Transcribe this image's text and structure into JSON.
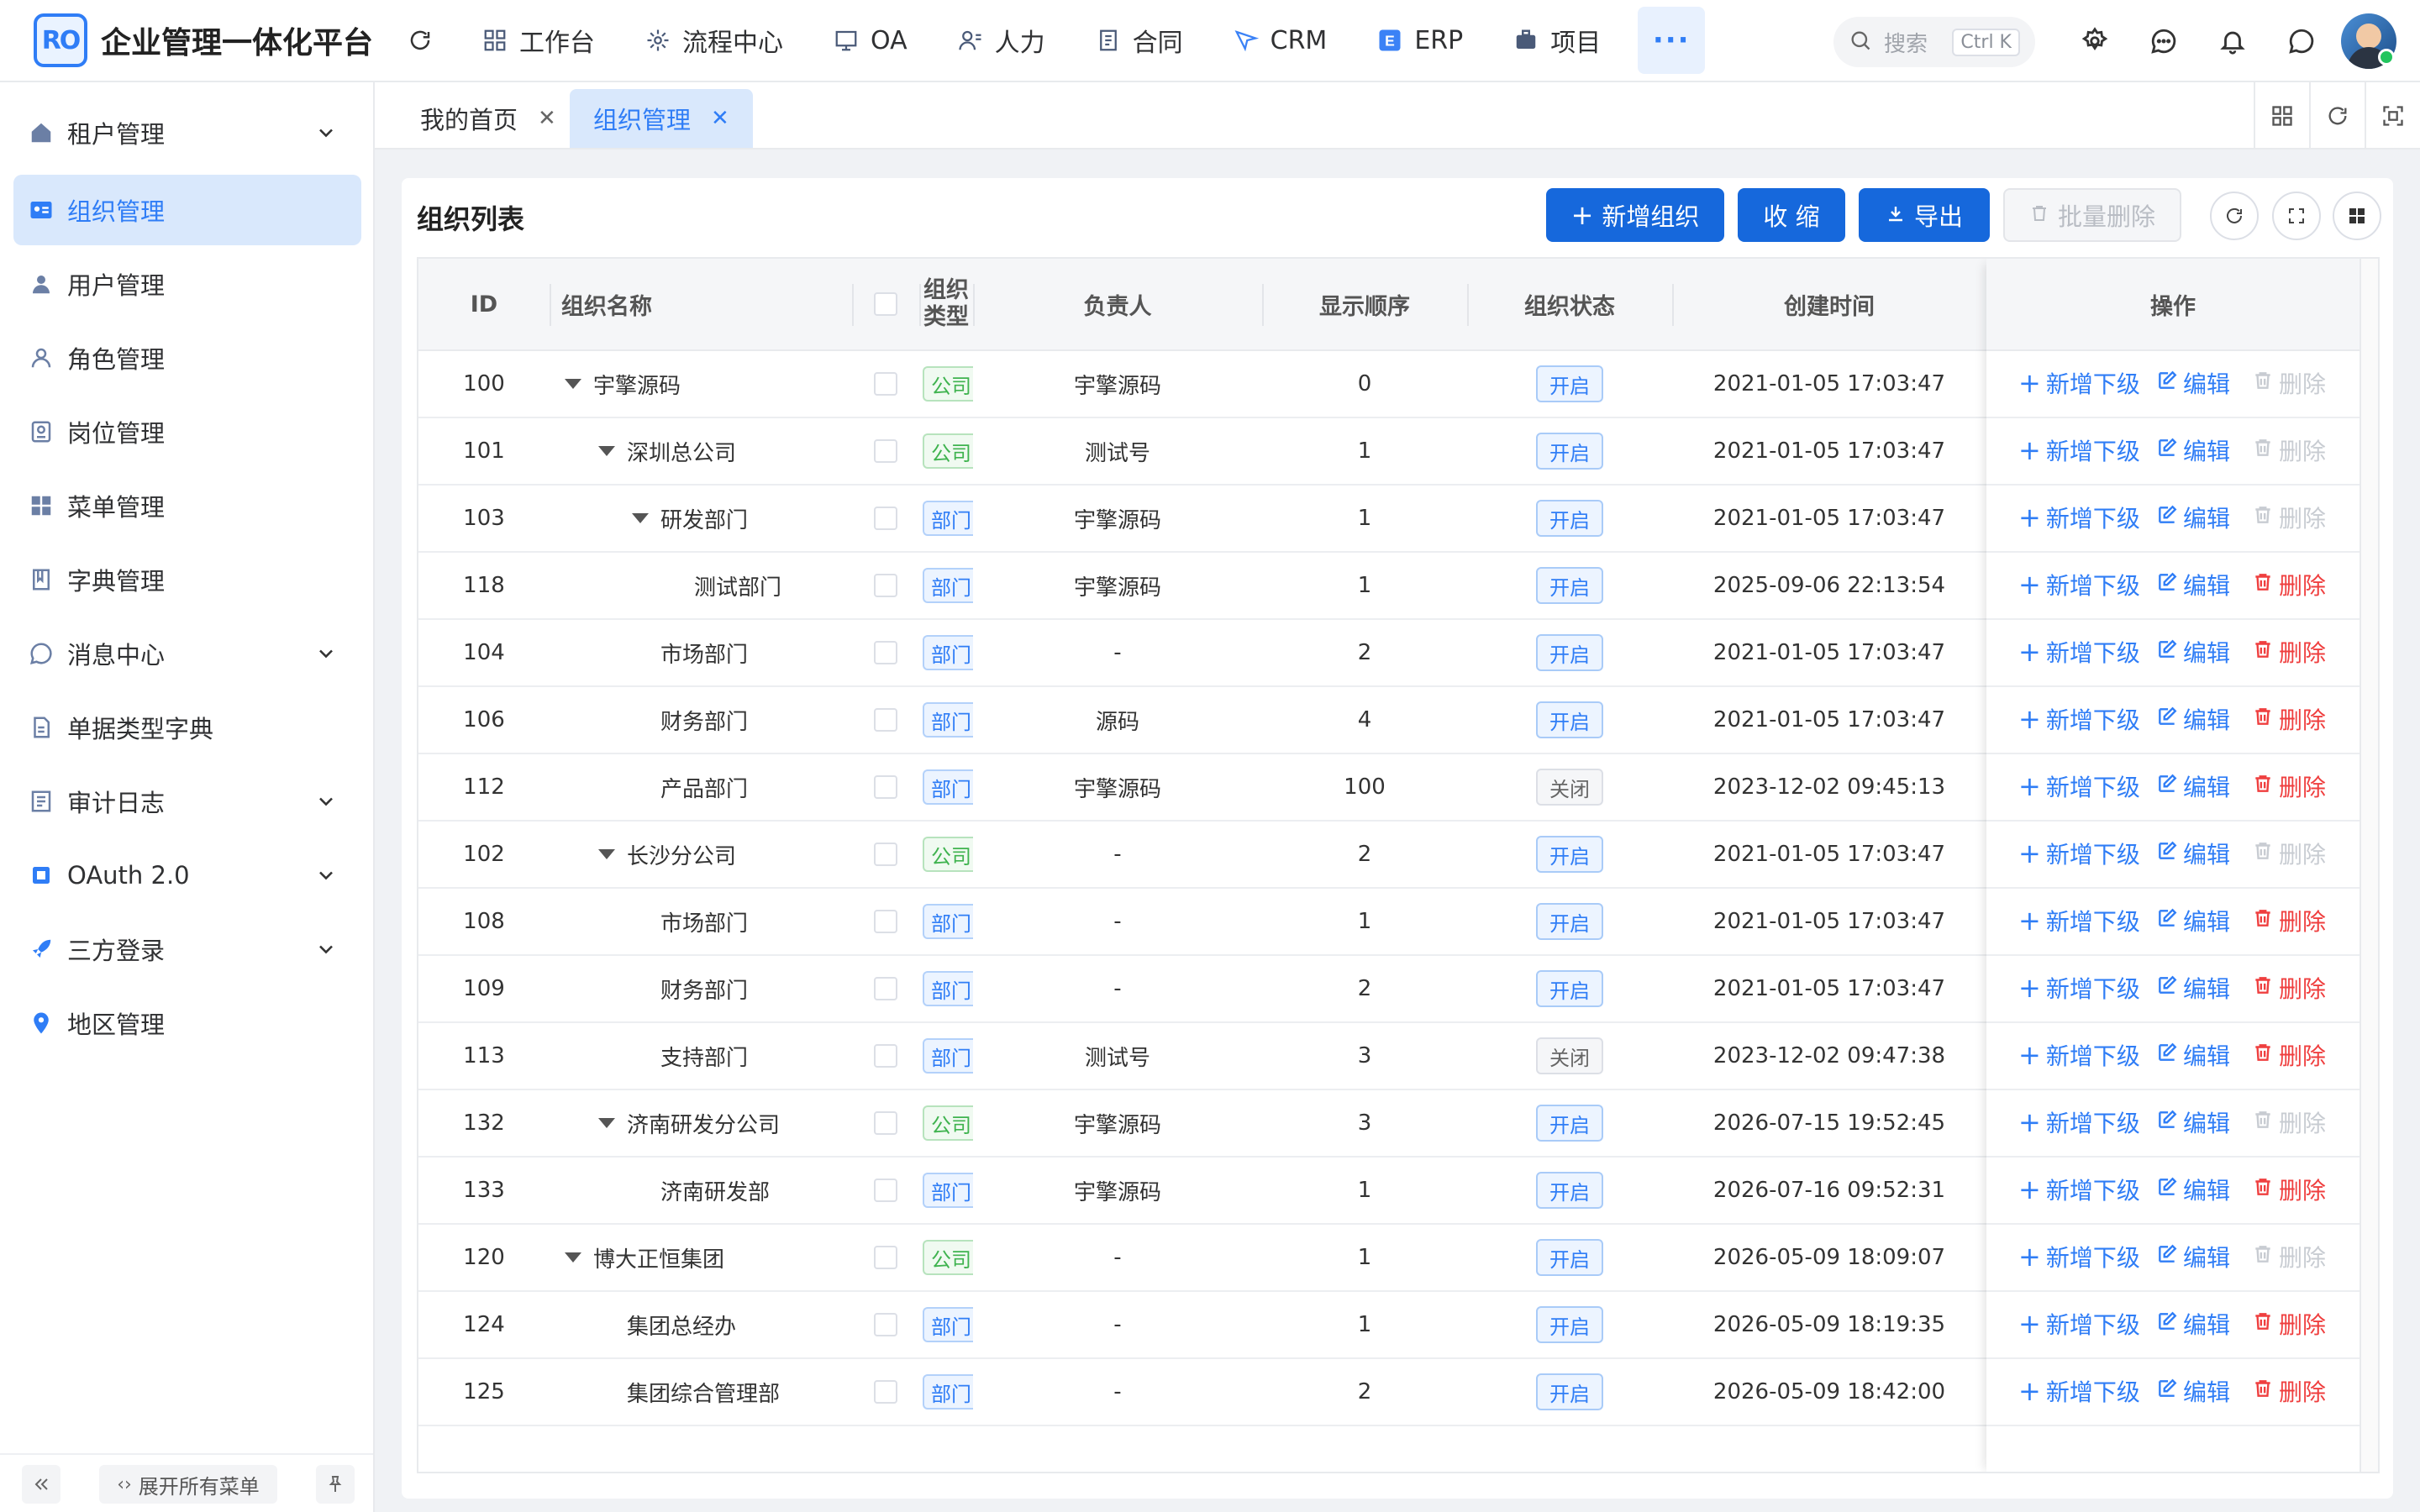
{
  "app": {
    "logo_text": "RO",
    "title": "企业管理一体化平台"
  },
  "topnav": [
    {
      "label": "工作台",
      "icon": "dashboard-icon"
    },
    {
      "label": "流程中心",
      "icon": "workflow-icon"
    },
    {
      "label": "OA",
      "icon": "oa-icon"
    },
    {
      "label": "人力",
      "icon": "hr-icon"
    },
    {
      "label": "合同",
      "icon": "contract-icon"
    },
    {
      "label": "CRM",
      "icon": "crm-icon"
    },
    {
      "label": "ERP",
      "icon": "erp-icon"
    },
    {
      "label": "项目",
      "icon": "project-icon"
    }
  ],
  "more_label": "···",
  "search": {
    "placeholder": "搜索",
    "shortcut": "Ctrl K"
  },
  "sidebar": {
    "items": [
      {
        "label": "租户管理",
        "icon": "tenant-icon",
        "expandable": true
      },
      {
        "label": "组织管理",
        "icon": "org-card-icon",
        "active": true
      },
      {
        "label": "用户管理",
        "icon": "user-icon"
      },
      {
        "label": "角色管理",
        "icon": "role-icon"
      },
      {
        "label": "岗位管理",
        "icon": "post-icon"
      },
      {
        "label": "菜单管理",
        "icon": "menu-grid-icon"
      },
      {
        "label": "字典管理",
        "icon": "dictionary-icon"
      },
      {
        "label": "消息中心",
        "icon": "message-icon",
        "expandable": true
      },
      {
        "label": "单据类型字典",
        "icon": "document-type-icon"
      },
      {
        "label": "审计日志",
        "icon": "audit-log-icon",
        "expandable": true
      },
      {
        "label": "OAuth 2.0",
        "icon": "oauth-icon",
        "expandable": true
      },
      {
        "label": "三方登录",
        "icon": "rocket-icon",
        "expandable": true
      },
      {
        "label": "地区管理",
        "icon": "location-pin-icon"
      }
    ],
    "expand_all_label": "展开所有菜单"
  },
  "tabs": [
    {
      "label": "我的首页",
      "active": false
    },
    {
      "label": "组织管理",
      "active": true
    }
  ],
  "page": {
    "title": "组织列表",
    "buttons": {
      "add": "新增组织",
      "collapse": "收 缩",
      "export": "导出",
      "batch_delete": "批量删除"
    }
  },
  "table": {
    "headers": {
      "id": "ID",
      "name": "组织名称",
      "type_line1": "组织",
      "type_line2": "类型",
      "leader": "负责人",
      "order": "显示顺序",
      "status": "组织状态",
      "created": "创建时间",
      "actions": "操作"
    },
    "action_labels": {
      "add_child": "新增下级",
      "edit": "编辑",
      "delete": "删除"
    },
    "rows": [
      {
        "id": "100",
        "name": "宇擎源码",
        "level": 0,
        "expanded": true,
        "type": "公司",
        "type_color": "green",
        "leader": "宇擎源码",
        "order": "0",
        "status": "开启",
        "status_on": true,
        "created": "2021-01-05 17:03:47",
        "delete_enabled": false
      },
      {
        "id": "101",
        "name": "深圳总公司",
        "level": 1,
        "expanded": true,
        "type": "公司",
        "type_color": "green",
        "leader": "测试号",
        "order": "1",
        "status": "开启",
        "status_on": true,
        "created": "2021-01-05 17:03:47",
        "delete_enabled": false
      },
      {
        "id": "103",
        "name": "研发部门",
        "level": 2,
        "expanded": true,
        "type": "部门",
        "type_color": "blue",
        "leader": "宇擎源码",
        "order": "1",
        "status": "开启",
        "status_on": true,
        "created": "2021-01-05 17:03:47",
        "delete_enabled": false
      },
      {
        "id": "118",
        "name": "测试部门",
        "level": 3,
        "expanded": false,
        "type": "部门",
        "type_color": "blue",
        "leader": "宇擎源码",
        "order": "1",
        "status": "开启",
        "status_on": true,
        "created": "2025-09-06 22:13:54",
        "delete_enabled": true
      },
      {
        "id": "104",
        "name": "市场部门",
        "level": 2,
        "expanded": false,
        "type": "部门",
        "type_color": "blue",
        "leader": "-",
        "order": "2",
        "status": "开启",
        "status_on": true,
        "created": "2021-01-05 17:03:47",
        "delete_enabled": true
      },
      {
        "id": "106",
        "name": "财务部门",
        "level": 2,
        "expanded": false,
        "type": "部门",
        "type_color": "blue",
        "leader": "源码",
        "order": "4",
        "status": "开启",
        "status_on": true,
        "created": "2021-01-05 17:03:47",
        "delete_enabled": true
      },
      {
        "id": "112",
        "name": "产品部门",
        "level": 2,
        "expanded": false,
        "type": "部门",
        "type_color": "blue",
        "leader": "宇擎源码",
        "order": "100",
        "status": "关闭",
        "status_on": false,
        "created": "2023-12-02 09:45:13",
        "delete_enabled": true
      },
      {
        "id": "102",
        "name": "长沙分公司",
        "level": 1,
        "expanded": true,
        "type": "公司",
        "type_color": "green",
        "leader": "-",
        "order": "2",
        "status": "开启",
        "status_on": true,
        "created": "2021-01-05 17:03:47",
        "delete_enabled": false
      },
      {
        "id": "108",
        "name": "市场部门",
        "level": 2,
        "expanded": false,
        "type": "部门",
        "type_color": "blue",
        "leader": "-",
        "order": "1",
        "status": "开启",
        "status_on": true,
        "created": "2021-01-05 17:03:47",
        "delete_enabled": true
      },
      {
        "id": "109",
        "name": "财务部门",
        "level": 2,
        "expanded": false,
        "type": "部门",
        "type_color": "blue",
        "leader": "-",
        "order": "2",
        "status": "开启",
        "status_on": true,
        "created": "2021-01-05 17:03:47",
        "delete_enabled": true
      },
      {
        "id": "113",
        "name": "支持部门",
        "level": 2,
        "expanded": false,
        "type": "部门",
        "type_color": "blue",
        "leader": "测试号",
        "order": "3",
        "status": "关闭",
        "status_on": false,
        "created": "2023-12-02 09:47:38",
        "delete_enabled": true
      },
      {
        "id": "132",
        "name": "济南研发分公司",
        "level": 1,
        "expanded": true,
        "type": "公司",
        "type_color": "green",
        "leader": "宇擎源码",
        "order": "3",
        "status": "开启",
        "status_on": true,
        "created": "2026-07-15 19:52:45",
        "delete_enabled": false
      },
      {
        "id": "133",
        "name": "济南研发部",
        "level": 2,
        "expanded": false,
        "type": "部门",
        "type_color": "blue",
        "leader": "宇擎源码",
        "order": "1",
        "status": "开启",
        "status_on": true,
        "created": "2026-07-16 09:52:31",
        "delete_enabled": true
      },
      {
        "id": "120",
        "name": "博大正恒集团",
        "level": 0,
        "expanded": true,
        "type": "公司",
        "type_color": "green",
        "leader": "-",
        "order": "1",
        "status": "开启",
        "status_on": true,
        "created": "2026-05-09 18:09:07",
        "delete_enabled": false
      },
      {
        "id": "124",
        "name": "集团总经办",
        "level": 1,
        "expanded": false,
        "type": "部门",
        "type_color": "blue",
        "leader": "-",
        "order": "1",
        "status": "开启",
        "status_on": true,
        "created": "2026-05-09 18:19:35",
        "delete_enabled": true
      },
      {
        "id": "125",
        "name": "集团综合管理部",
        "level": 1,
        "expanded": false,
        "type": "部门",
        "type_color": "blue",
        "leader": "-",
        "order": "2",
        "status": "开启",
        "status_on": true,
        "created": "2026-05-09 18:42:00",
        "delete_enabled": true
      }
    ]
  },
  "colors": {
    "primary": "#1668dc",
    "accent": "#2f7df6",
    "danger": "#ef3f3f",
    "success": "#3fb34f"
  }
}
